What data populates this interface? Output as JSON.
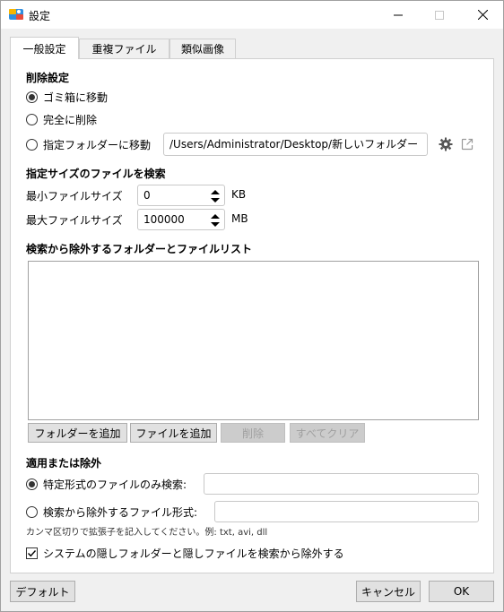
{
  "window": {
    "title": "設定",
    "app_icon": "app-icon",
    "buttons": {
      "minimize": "—",
      "maximize": "☐",
      "close": "✕"
    }
  },
  "tabs": [
    {
      "label": "一般設定",
      "active": true
    },
    {
      "label": "重複ファイル",
      "active": false
    },
    {
      "label": "類似画像",
      "active": false
    }
  ],
  "delete_settings": {
    "title": "削除設定",
    "options": [
      {
        "label": "ゴミ箱に移動",
        "checked": true
      },
      {
        "label": "完全に削除",
        "checked": false
      },
      {
        "label": "指定フォルダーに移動",
        "checked": false
      }
    ],
    "folder_path": "/Users/Administrator/Desktop/新しいフォルダー",
    "settings_icon": "gear-icon",
    "open_icon": "external-link-icon"
  },
  "size_filter": {
    "title": "指定サイズのファイルを検索",
    "min_label": "最小ファイルサイズ",
    "min_value": "0",
    "min_unit": "KB",
    "max_label": "最大ファイルサイズ",
    "max_value": "100000",
    "max_unit": "MB"
  },
  "exclude_list": {
    "title": "検索から除外するフォルダーとファイルリスト",
    "items": [],
    "buttons": {
      "add_folder": "フォルダーを追加",
      "add_file": "ファイルを追加",
      "delete": "削除",
      "clear_all": "すべてクリア"
    }
  },
  "apply_exclude": {
    "title": "適用または除外",
    "options": [
      {
        "label": "特定形式のファイルのみ検索:",
        "checked": true,
        "value": ""
      },
      {
        "label": "検索から除外するファイル形式:",
        "checked": false,
        "value": ""
      }
    ],
    "hint": "カンマ区切りで拡張子を記入してください。例: txt, avi, dll"
  },
  "hidden_check": {
    "label": "システムの隠しフォルダーと隠しファイルを検索から除外する",
    "checked": true
  },
  "footer": {
    "default": "デフォルト",
    "cancel": "キャンセル",
    "ok": "OK"
  },
  "colors": {
    "accent": "#0078d7",
    "window_bg": "#f0f0f0",
    "panel_bg": "#ffffff"
  }
}
